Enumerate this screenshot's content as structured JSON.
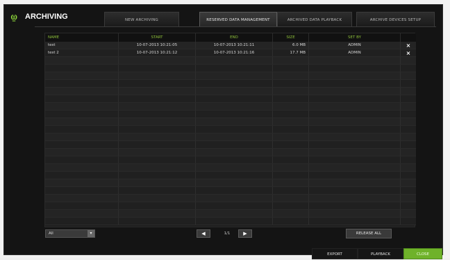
{
  "window": {
    "title": "ARCHIVING"
  },
  "tabs": [
    {
      "label": "NEW ARCHIVING",
      "active": false
    },
    {
      "label": "RESERVED DATA MANAGEMENT",
      "active": true
    },
    {
      "label": "ARCHIVED DATA PLAYBACK",
      "active": false
    },
    {
      "label": "ARCHIVE DEVICES SETUP",
      "active": false
    }
  ],
  "table": {
    "columns": [
      "NAME",
      "START",
      "END",
      "SIZE",
      "SET BY"
    ],
    "rows": [
      {
        "name": "test",
        "start": "10-07-2013 10:21:05",
        "end": "10-07-2013 10:21:11",
        "size": "6.0 MB",
        "set_by": "ADMIN",
        "delete_label": "×"
      },
      {
        "name": "test 2",
        "start": "10-07-2013 10:21:12",
        "end": "10-07-2013 10:21:16",
        "size": "17.7 MB",
        "set_by": "ADMIN",
        "delete_label": "×"
      }
    ],
    "empty_rows": 22
  },
  "filter": {
    "value": "All",
    "arrow": "▾"
  },
  "pager": {
    "prev": "◀",
    "next": "▶",
    "text": "1/1"
  },
  "release_all_label": "RELEASE ALL",
  "bottom": {
    "export": "EXPORT",
    "playback": "PLAYBACK",
    "close": "CLOSE"
  },
  "colors": {
    "accent": "#8dbf3a",
    "primary_button": "#6fb22a"
  }
}
